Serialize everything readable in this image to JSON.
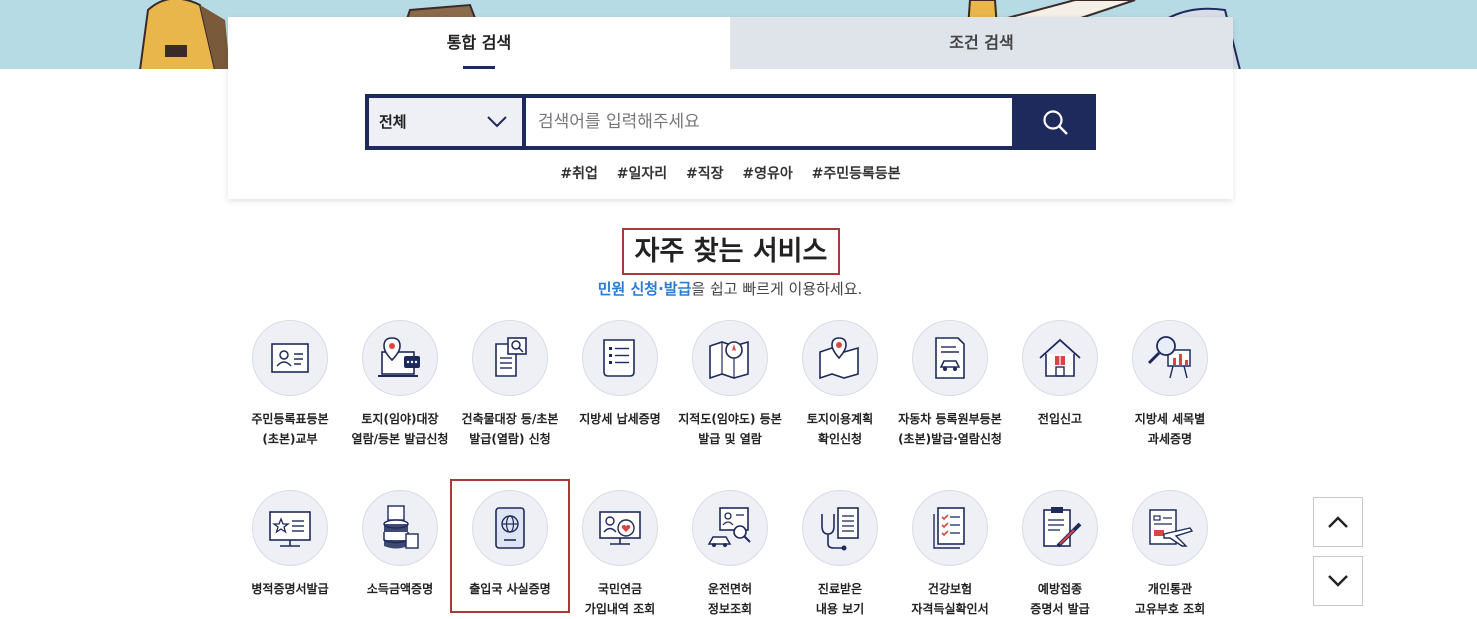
{
  "search": {
    "tabs": [
      {
        "label": "통합 검색",
        "active": true
      },
      {
        "label": "조건 검색",
        "active": false
      }
    ],
    "category_selected": "전체",
    "placeholder": "검색어를 입력해주세요",
    "tags": [
      "#취업",
      "#일자리",
      "#직장",
      "#영유아",
      "#주민등록등본"
    ]
  },
  "section": {
    "title": "자주 찾는 서비스",
    "subtitle_highlight": "민원 신청·발급",
    "subtitle_rest": "을 쉽고 빠르게 이용하세요."
  },
  "services_row1": [
    {
      "label": "주민등록표등본\n(초본)교부",
      "icon": "id-card-icon"
    },
    {
      "label": "토지(임야)대장\n열람/등본 발급신청",
      "icon": "land-map-pin-icon"
    },
    {
      "label": "건축물대장 등/초본\n발급(열람) 신청",
      "icon": "document-search-icon"
    },
    {
      "label": "지방세 납세증명",
      "icon": "receipt-list-icon"
    },
    {
      "label": "지적도(임야도) 등본\n발급 및 열람",
      "icon": "map-compass-icon"
    },
    {
      "label": "토지이용계획\n확인신청",
      "icon": "map-location-icon"
    },
    {
      "label": "자동차 등록원부등본\n(초본)발급·열람신청",
      "icon": "car-document-icon"
    },
    {
      "label": "전입신고",
      "icon": "house-icon"
    },
    {
      "label": "지방세 세목별\n과세증명",
      "icon": "magnifier-chart-icon"
    }
  ],
  "services_row2": [
    {
      "label": "병적증명서발급",
      "icon": "monitor-star-icon"
    },
    {
      "label": "소득금액증명",
      "icon": "coin-stack-icon"
    },
    {
      "label": "출입국 사실증명",
      "icon": "passport-icon"
    },
    {
      "label": "국민연금\n가입내역 조회",
      "icon": "pension-heart-icon"
    },
    {
      "label": "운전면허\n정보조회",
      "icon": "license-car-icon"
    },
    {
      "label": "진료받은\n내용 보기",
      "icon": "stethoscope-icon"
    },
    {
      "label": "건강보험\n자격득실확인서",
      "icon": "checklist-icon"
    },
    {
      "label": "예방접종\n증명서 발급",
      "icon": "syringe-clipboard-icon"
    },
    {
      "label": "개인통관\n고유부호 조회",
      "icon": "ticket-plane-icon"
    }
  ],
  "colors": {
    "navy": "#1f2a5c",
    "accent_red": "#a83a3a",
    "highlight_blue": "#2a7ad6"
  }
}
